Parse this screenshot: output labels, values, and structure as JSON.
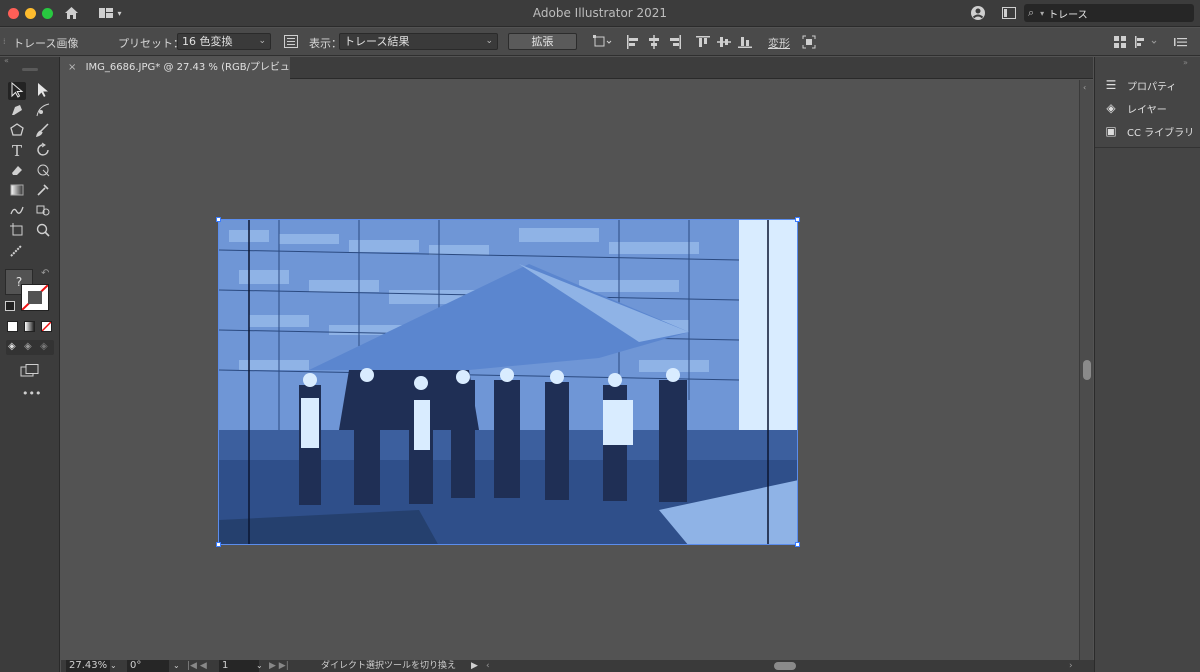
{
  "app": {
    "title": "Adobe Illustrator 2021",
    "search_value": "トレース"
  },
  "control_bar": {
    "context_label": "トレース画像",
    "preset_label": "プリセット：",
    "preset_value": "16 色変換",
    "view_label": "表示：",
    "view_value": "トレース結果",
    "expand_label": "拡張",
    "transform_label": "変形"
  },
  "document": {
    "tab_title": "IMG_6686.JPG* @ 27.43 % (RGB/プレビュー)"
  },
  "panels": {
    "items": [
      {
        "label": "プロパティ",
        "icon": "properties-icon"
      },
      {
        "label": "レイヤー",
        "icon": "layers-icon"
      },
      {
        "label": "CC ライブラリ",
        "icon": "libraries-icon"
      }
    ]
  },
  "status": {
    "zoom": "27.43%",
    "rotation": "0°",
    "artboard": "1",
    "message": "ダイレクト選択ツールを切り換え"
  },
  "toolbar": {
    "fill_unknown": "?",
    "more_tools": "•••"
  },
  "colors": {
    "accent": "#3a7cff",
    "trace_dark": "#1f2f55",
    "trace_mid": "#3c5f9e",
    "trace_light": "#8fb3e6",
    "trace_pale": "#d9ecff"
  }
}
